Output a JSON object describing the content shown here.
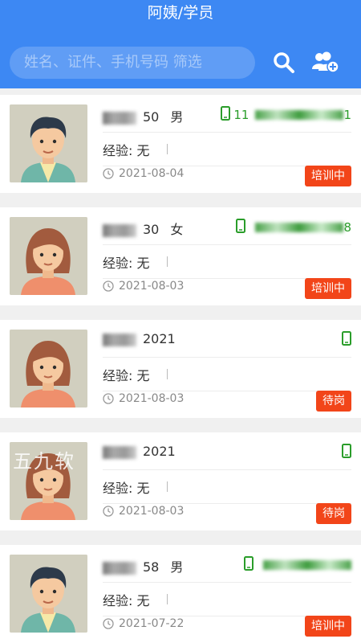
{
  "header": {
    "title": "阿姨/学员",
    "search_placeholder": "姓名、证件、手机号码 筛选"
  },
  "icons": {
    "search": "search-icon",
    "add_user": "add-user-icon",
    "phone": "phone-icon",
    "clock": "clock-icon"
  },
  "colors": {
    "header_bg": "#3d88f3",
    "badge": "#f24519",
    "phone": "#2a9d2a"
  },
  "labels": {
    "experience": "经验: 无"
  },
  "cards": [
    {
      "age": "50",
      "gender": "男",
      "date": "2021-08-04",
      "status": "培训中",
      "avatar": "male",
      "phone_prefix": "11",
      "phone_suffix": "1"
    },
    {
      "age": "30",
      "gender": "女",
      "date": "2021-08-03",
      "status": "培训中",
      "avatar": "female",
      "phone_prefix": "",
      "phone_suffix": "8"
    },
    {
      "age": "2021",
      "gender": "",
      "date": "2021-08-03",
      "status": "待岗",
      "avatar": "female",
      "phone_prefix": "",
      "phone_suffix": ""
    },
    {
      "age": "2021",
      "gender": "",
      "date": "2021-08-03",
      "status": "待岗",
      "avatar": "female",
      "phone_prefix": "",
      "phone_suffix": ""
    },
    {
      "age": "58",
      "gender": "男",
      "date": "2021-07-22",
      "status": "培训中",
      "avatar": "male",
      "phone_prefix": "",
      "phone_suffix": ""
    }
  ],
  "watermark": "五九软"
}
